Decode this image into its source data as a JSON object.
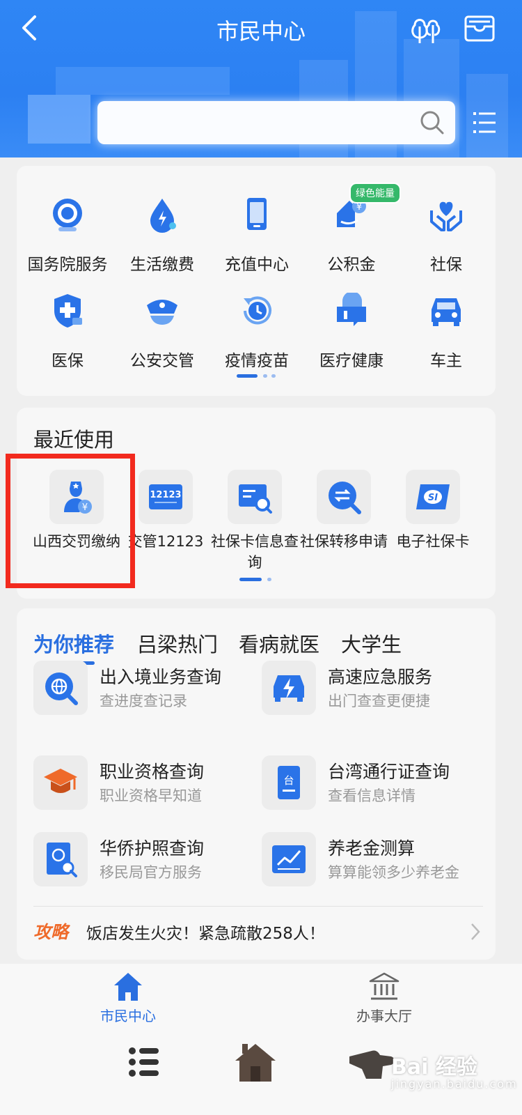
{
  "header": {
    "title": "市民中心",
    "icons": [
      "back-arrow-icon",
      "trees-icon",
      "wallet-icon"
    ],
    "search": {
      "placeholder": "",
      "icon": "search-icon"
    },
    "menu_icon": "list-icon"
  },
  "services": {
    "items": [
      {
        "label": "国务院服务",
        "icon": "state-council-icon"
      },
      {
        "label": "生活缴费",
        "icon": "drop-lightning-icon"
      },
      {
        "label": "充值中心",
        "icon": "phone-icon"
      },
      {
        "label": "公积金",
        "icon": "housing-fund-icon",
        "badge": "绿色能量"
      },
      {
        "label": "社保",
        "icon": "hands-heart-icon"
      },
      {
        "label": "医保",
        "icon": "medical-shield-icon"
      },
      {
        "label": "公安交管",
        "icon": "police-cap-icon"
      },
      {
        "label": "疫情疫苗",
        "icon": "clock-refresh-icon"
      },
      {
        "label": "医疗健康",
        "icon": "health-chat-icon"
      },
      {
        "label": "车主",
        "icon": "car-icon"
      }
    ],
    "page_indicator": {
      "pages": 3,
      "active": 0
    }
  },
  "recent": {
    "title": "最近使用",
    "items": [
      {
        "label": "山西交罚缴纳",
        "icon": "traffic-fine-icon"
      },
      {
        "label": "交管12123",
        "icon": "app-12123-icon",
        "tile_text": "12123"
      },
      {
        "label": "社保卡信息查询",
        "icon": "card-search-icon"
      },
      {
        "label": "社保转移申请",
        "icon": "transfer-search-icon"
      },
      {
        "label": "电子社保卡",
        "icon": "si-card-icon",
        "tile_text": "SI"
      }
    ],
    "page_indicator": {
      "pages": 2,
      "active": 0
    }
  },
  "recommend": {
    "tabs": [
      "为你推荐",
      "吕梁热门",
      "看病就医",
      "大学生"
    ],
    "active_tab": 0,
    "items": [
      {
        "title": "出入境业务查询",
        "subtitle": "查进度查记录",
        "icon": "globe-search-icon"
      },
      {
        "title": "高速应急服务",
        "subtitle": "出门查查更便捷",
        "icon": "highway-bolt-icon"
      },
      {
        "title": "职业资格查询",
        "subtitle": "职业资格早知道",
        "icon": "graduation-cap-icon"
      },
      {
        "title": "台湾通行证查询",
        "subtitle": "查看信息详情",
        "icon": "taiwan-pass-icon",
        "tile_text": "台"
      },
      {
        "title": "华侨护照查询",
        "subtitle": "移民局官方服务",
        "icon": "passport-search-icon"
      },
      {
        "title": "养老金测算",
        "subtitle": "算算能领多少养老金",
        "icon": "line-chart-icon"
      }
    ],
    "news": {
      "tag": "攻略",
      "text": "饭店发生火灾！紧急疏散258人！"
    }
  },
  "bottom_nav": [
    {
      "label": "市民中心",
      "icon": "home-icon",
      "active": true
    },
    {
      "label": "办事大厅",
      "icon": "bank-building-icon",
      "active": false
    }
  ],
  "watermark": {
    "text": "Bai 经验",
    "sub": "jingyan.baidu.com"
  },
  "colors": {
    "primary": "#2a6fe0",
    "header": "#2f86f5",
    "highlight": "#f22a1e",
    "badge": "#35b86a",
    "tag": "#ef6a2a"
  }
}
